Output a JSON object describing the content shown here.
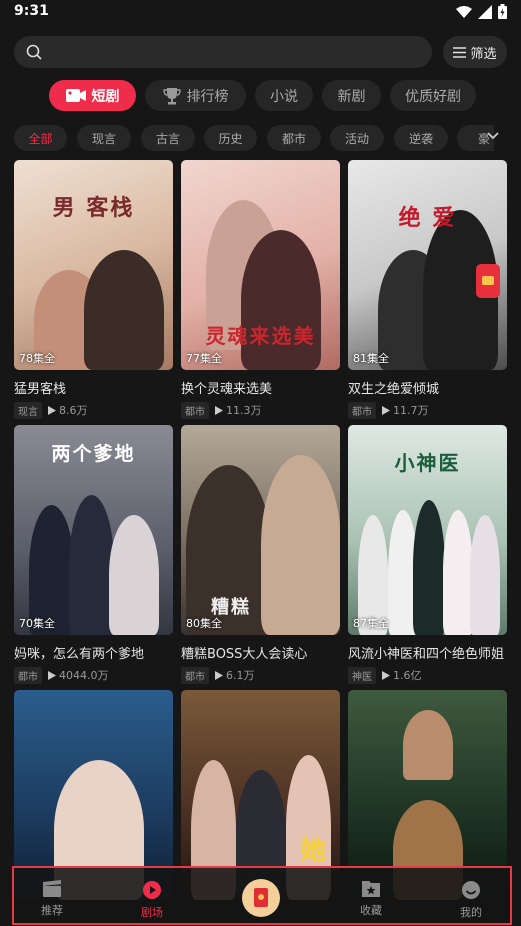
{
  "status": {
    "time": "9:31"
  },
  "search": {
    "placeholder": "",
    "filter_label": "筛选"
  },
  "category_tabs": [
    {
      "label": "短剧",
      "active": true,
      "icon": "video-icon"
    },
    {
      "label": "排行榜",
      "active": false,
      "icon": "trophy-icon"
    },
    {
      "label": "小说",
      "active": false
    },
    {
      "label": "新剧",
      "active": false
    },
    {
      "label": "优质好剧",
      "active": false
    }
  ],
  "genres": [
    "全部",
    "现言",
    "古言",
    "历史",
    "都市",
    "活动",
    "逆袭",
    "豪"
  ],
  "active_genre": "全部",
  "cards": [
    {
      "episodes": "78集全",
      "title": "猛男客栈",
      "tag": "现言",
      "views": "8.6万",
      "poster_text": "男 客栈",
      "accent": "#e8c9b3"
    },
    {
      "episodes": "77集全",
      "title": "换个灵魂来选美",
      "tag": "都市",
      "views": "11.3万",
      "poster_text": "灵魂来选美",
      "accent": "#e9b2a6"
    },
    {
      "episodes": "81集全",
      "title": "双生之绝爱倾城",
      "tag": "都市",
      "views": "11.7万",
      "poster_text": "绝 爱",
      "accent": "#c9c9c9"
    },
    {
      "episodes": "70集全",
      "title": "妈咪，怎么有两个爹地",
      "tag": "都市",
      "views": "4044.0万",
      "poster_text": "两个爹地",
      "accent": "#6e6e78"
    },
    {
      "episodes": "80集全",
      "title": "糟糕BOSS大人会读心",
      "tag": "都市",
      "views": "6.1万",
      "poster_text": "糟糕",
      "accent": "#8c7e6e"
    },
    {
      "episodes": "87集全",
      "title": "风流小神医和四个绝色师姐",
      "tag": "神医",
      "views": "1.6亿",
      "poster_text": "小神医",
      "accent": "#9fb7a9"
    },
    {
      "episodes": "",
      "title": "",
      "tag": "",
      "views": "",
      "poster_text": "",
      "accent": "#1c3b5e"
    },
    {
      "episodes": "",
      "title": "",
      "tag": "",
      "views": "",
      "poster_text": "她",
      "accent": "#4a2f22"
    },
    {
      "episodes": "",
      "title": "",
      "tag": "",
      "views": "",
      "poster_text": "",
      "accent": "#1e3323"
    }
  ],
  "tab_bar": [
    {
      "label": "推荐",
      "icon": "clapper-icon",
      "active": false
    },
    {
      "label": "剧场",
      "icon": "play-circle-icon",
      "active": true
    },
    {
      "label": "",
      "icon": "red-envelope-icon",
      "active": false
    },
    {
      "label": "收藏",
      "icon": "bookmark-star-icon",
      "active": false
    },
    {
      "label": "我的",
      "icon": "profile-icon",
      "active": false
    }
  ],
  "colors": {
    "accent": "#ef2d4a",
    "background": "#161616",
    "tab_bar_border": "#e83a44"
  }
}
